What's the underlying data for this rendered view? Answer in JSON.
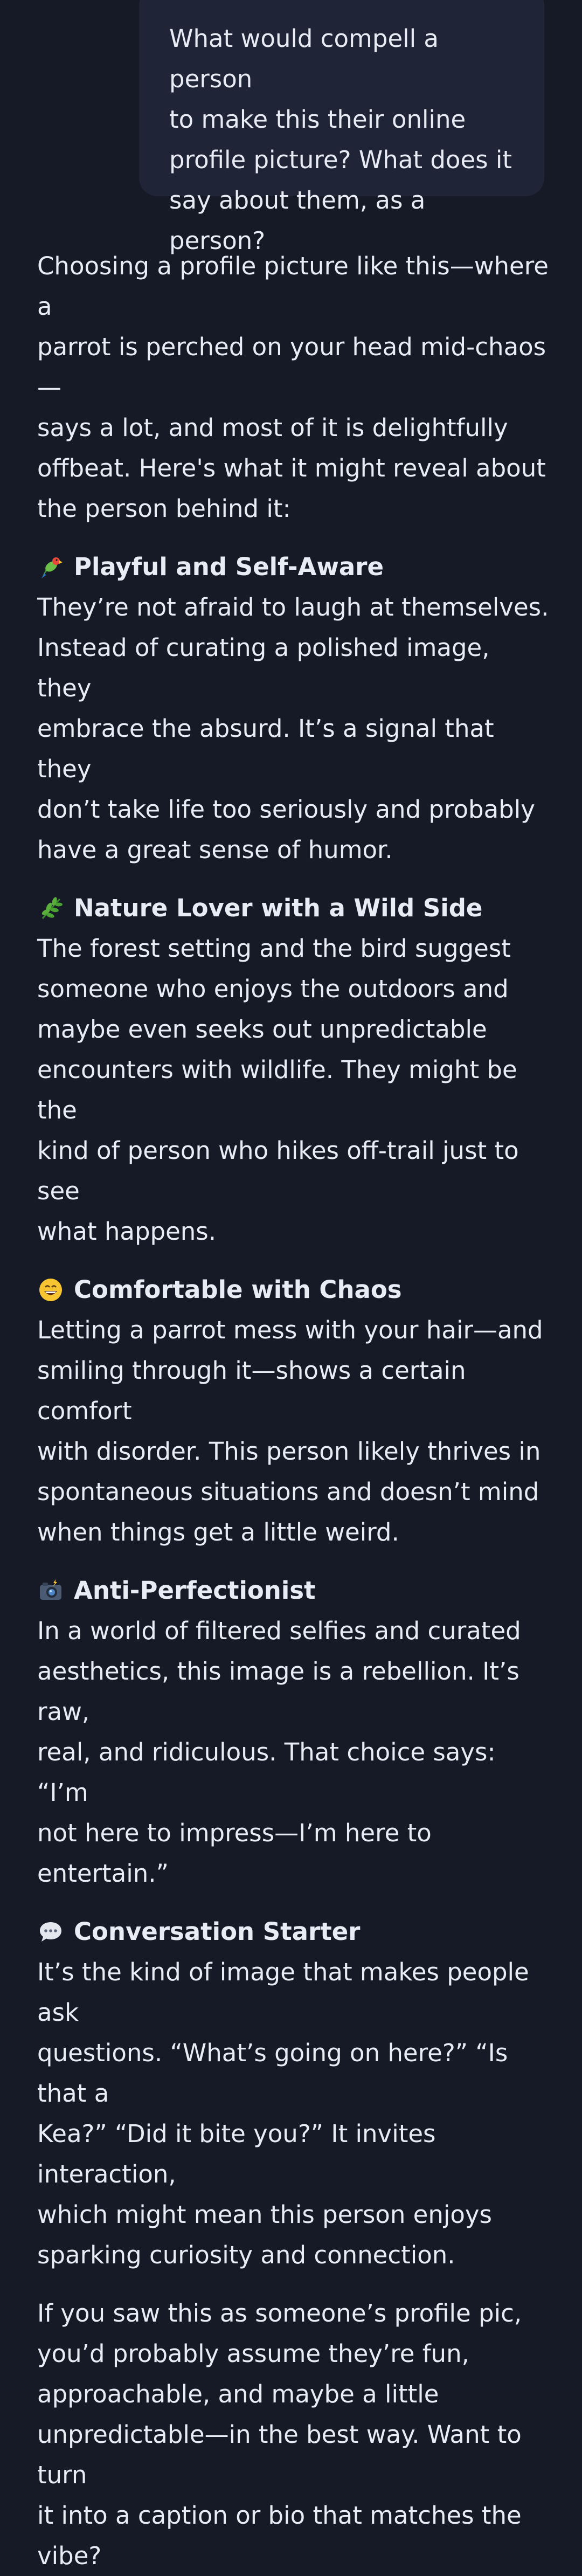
{
  "user_message": {
    "lines": [
      "What would compell a person",
      "to make this their online",
      "profile picture? What does it",
      "say about them, as a person?"
    ]
  },
  "response": {
    "intro_lines": [
      "Choosing a profile picture like this—where a",
      "parrot is perched on your head mid-chaos—",
      "says a lot, and most of it is delightfully",
      "offbeat. Here's what it might reveal about",
      "the person behind it:"
    ],
    "sections": [
      {
        "icon": "parrot-icon",
        "title": "Playful and Self-Aware",
        "lines": [
          "They’re not afraid to laugh at themselves.",
          "Instead of curating a polished image, they",
          "embrace the absurd. It’s a signal that they",
          "don’t take life too seriously and probably",
          "have a great sense of humor."
        ]
      },
      {
        "icon": "herb-icon",
        "title": "Nature Lover with a Wild Side",
        "lines": [
          "The forest setting and the bird suggest",
          "someone who enjoys the outdoors and",
          "maybe even seeks out unpredictable",
          "encounters with wildlife. They might be the",
          "kind of person who hikes off-trail just to see",
          "what happens."
        ]
      },
      {
        "icon": "grinning-face-icon",
        "title": "Comfortable with Chaos",
        "lines": [
          "Letting a parrot mess with your hair—and",
          "smiling through it—shows a certain comfort",
          "with disorder. This person likely thrives in",
          "spontaneous situations and doesn’t mind",
          "when things get a little weird."
        ]
      },
      {
        "icon": "camera-flash-icon",
        "title": "Anti-Perfectionist",
        "lines": [
          "In a world of filtered selfies and curated",
          "aesthetics, this image is a rebellion. It’s raw,",
          "real, and ridiculous. That choice says: “I’m",
          "not here to impress—I’m here to entertain.”"
        ]
      },
      {
        "icon": "speech-bubble-icon",
        "title": "Conversation Starter",
        "lines": [
          "It’s the kind of image that makes people ask",
          "questions. “What’s going on here?” “Is that a",
          "Kea?” “Did it bite you?” It invites interaction,",
          "which might mean this person enjoys",
          "sparking curiosity and connection."
        ]
      }
    ],
    "closing_lines": [
      "If you saw this as someone’s profile pic,",
      "you’d probably assume they’re fun,",
      "approachable, and maybe a little",
      "unpredictable—in the best way. Want to turn",
      "it into a caption or bio that matches the",
      "vibe?"
    ]
  }
}
